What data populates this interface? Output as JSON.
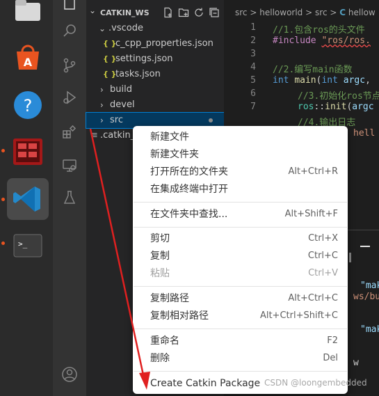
{
  "explorer": {
    "title": "CATKIN_WS",
    "items": [
      {
        "label": ".vscode",
        "chevron": "⌄"
      },
      {
        "label": "c_cpp_properties.json",
        "glyph": "{ }"
      },
      {
        "label": "settings.json",
        "glyph": "{ }"
      },
      {
        "label": "tasks.json",
        "glyph": "{ }"
      },
      {
        "label": "build",
        "chevron": "›"
      },
      {
        "label": "devel",
        "chevron": "›"
      },
      {
        "label": "src",
        "chevron": "›"
      },
      {
        "label": ".catkin_workspace",
        "glyph": "≡"
      }
    ]
  },
  "editor": {
    "breadcrumb": [
      "src",
      "helloworld",
      "src",
      "hellow"
    ],
    "breadcrumb_sep": ">",
    "line_numbers": [
      "1",
      "2",
      "3",
      "4",
      "5",
      "6",
      "7"
    ],
    "lines": {
      "l1": "//1.包含ros的头文件",
      "l2_kw": "#include",
      "l2_str": "\"ros/ros.",
      "l4": "//2.编写main函数",
      "l5_kw": "int",
      "l5_fn": "main",
      "l5_rest": "(",
      "l5_kw2": "int",
      "l5_var": "argc",
      "l5_end": ",",
      "l6": "//3.初始化ros节点",
      "l7_ns": "ros",
      "l7_op": "::",
      "l7_fn": "init",
      "l7_rest": "(",
      "l7_var": "argc",
      "l8": "//4.输出日志",
      "l9_str": "hell"
    }
  },
  "panel": {
    "frag1": "\"mak",
    "frag2": "ws/bu",
    "frag3": "\"mak",
    "frag4": "w"
  },
  "context_menu": {
    "groups": [
      [
        {
          "label": "新建文件",
          "shortcut": ""
        },
        {
          "label": "新建文件夹",
          "shortcut": ""
        },
        {
          "label": "打开所在的文件夹",
          "shortcut": "Alt+Ctrl+R"
        },
        {
          "label": "在集成终端中打开",
          "shortcut": ""
        }
      ],
      [
        {
          "label": "在文件夹中查找...",
          "shortcut": "Alt+Shift+F"
        }
      ],
      [
        {
          "label": "剪切",
          "shortcut": "Ctrl+X"
        },
        {
          "label": "复制",
          "shortcut": "Ctrl+C"
        },
        {
          "label": "粘贴",
          "shortcut": "Ctrl+V",
          "disabled": true
        }
      ],
      [
        {
          "label": "复制路径",
          "shortcut": "Alt+Ctrl+C"
        },
        {
          "label": "复制相对路径",
          "shortcut": "Alt+Ctrl+Shift+C"
        }
      ],
      [
        {
          "label": "重命名",
          "shortcut": "F2"
        },
        {
          "label": "删除",
          "shortcut": "Del"
        }
      ],
      [
        {
          "label": "Create Catkin Package",
          "shortcut": ""
        }
      ]
    ]
  },
  "watermark": "CSDN @loongembedded",
  "colors": {
    "accent": "#007acc",
    "arrow": "#e02020",
    "selection": "#04395e"
  }
}
